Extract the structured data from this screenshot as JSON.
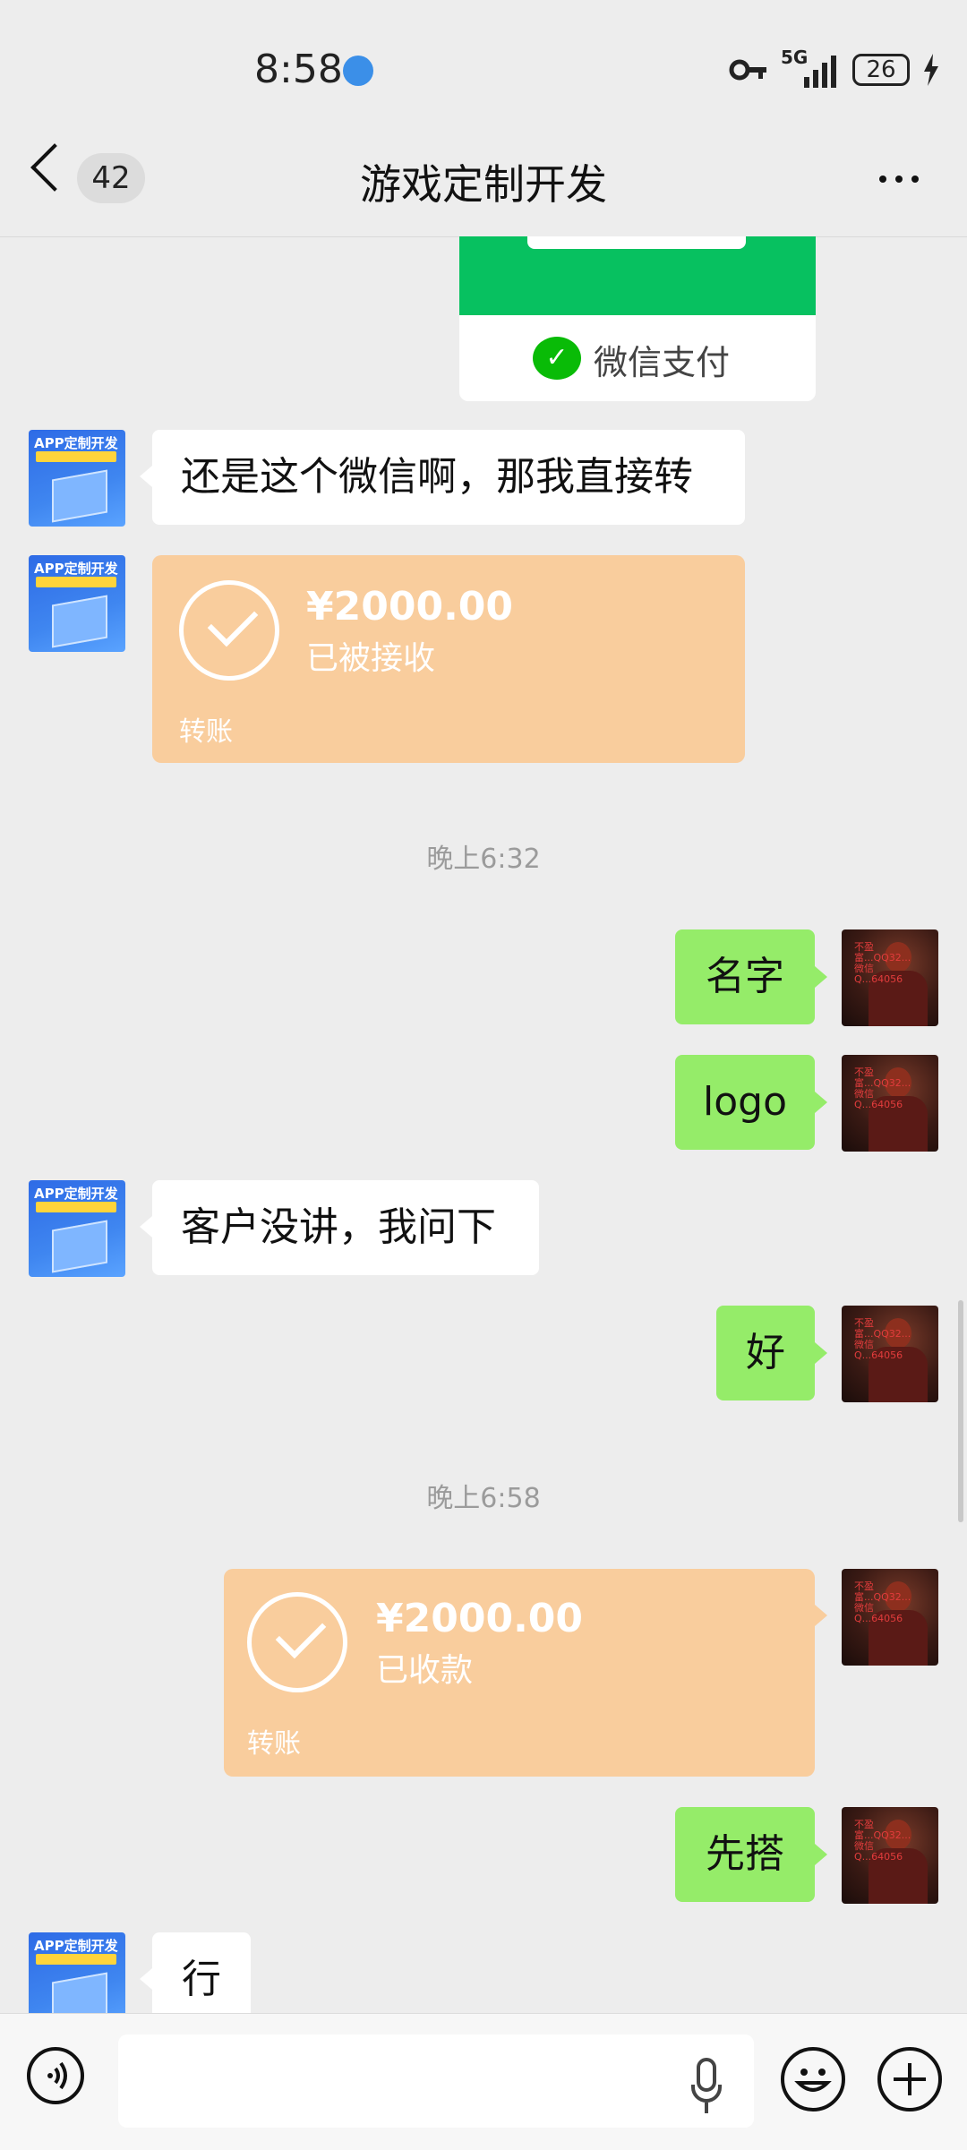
{
  "status_bar": {
    "time": "8:58",
    "network": "5G",
    "battery": "26",
    "icons": [
      "key-icon",
      "signal-icon",
      "battery-icon",
      "charging-icon"
    ]
  },
  "header": {
    "unread_count": "42",
    "title": "游戏定制开发",
    "more_icon": "more-icon"
  },
  "pay_card": {
    "label": "微信支付"
  },
  "avatars": {
    "left_title": "APP定制开发",
    "right_overlay": "不盈富...QQ32...微信Q...64056"
  },
  "messages": [
    {
      "side": "left",
      "text": "还是这个微信啊，那我直接转"
    },
    {
      "side": "left",
      "type": "transfer",
      "amount": "¥2000.00",
      "status": "已被接收",
      "label": "转账"
    },
    {
      "type": "time",
      "text": "晚上6:32"
    },
    {
      "side": "right",
      "text": "名字"
    },
    {
      "side": "right",
      "text": "logo"
    },
    {
      "side": "left",
      "text": "客户没讲，我问下"
    },
    {
      "side": "right",
      "text": "好"
    },
    {
      "type": "time",
      "text": "晚上6:58"
    },
    {
      "side": "right",
      "type": "transfer",
      "amount": "¥2000.00",
      "status": "已收款",
      "label": "转账"
    },
    {
      "side": "right",
      "text": "先搭"
    },
    {
      "side": "left",
      "text": "行"
    }
  ],
  "colors": {
    "background": "#ededed",
    "bubble_right": "#95ec69",
    "bubble_left": "#ffffff",
    "transfer": "#f9cd9d",
    "wechat_pay_green": "#07c160"
  }
}
